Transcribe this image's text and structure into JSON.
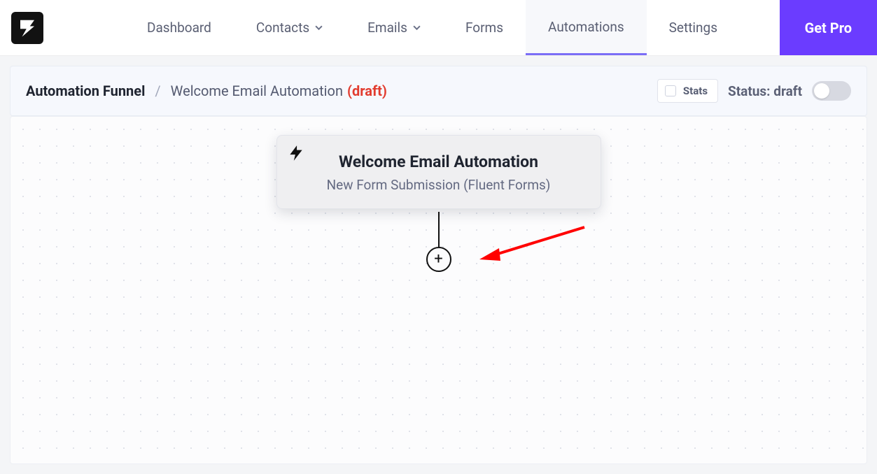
{
  "nav": {
    "items": [
      {
        "label": "Dashboard",
        "hasDropdown": false
      },
      {
        "label": "Contacts",
        "hasDropdown": true
      },
      {
        "label": "Emails",
        "hasDropdown": true
      },
      {
        "label": "Forms",
        "hasDropdown": false
      },
      {
        "label": "Automations",
        "hasDropdown": false,
        "active": true
      },
      {
        "label": "Settings",
        "hasDropdown": false
      }
    ],
    "getPro": "Get Pro"
  },
  "breadcrumb": {
    "root": "Automation Funnel",
    "name": "Welcome Email Automation",
    "draftTag": "(draft)"
  },
  "controls": {
    "statsLabel": "Stats",
    "statusLabel": "Status: draft",
    "statusActive": false,
    "statsChecked": false
  },
  "triggerCard": {
    "title": "Welcome Email Automation",
    "subtitle": "New Form Submission (Fluent Forms)"
  },
  "addButton": {
    "glyph": "+"
  },
  "colors": {
    "accent": "#6b3cff",
    "draft": "#e23c2f",
    "tabIndicator": "#7b6ef6"
  }
}
